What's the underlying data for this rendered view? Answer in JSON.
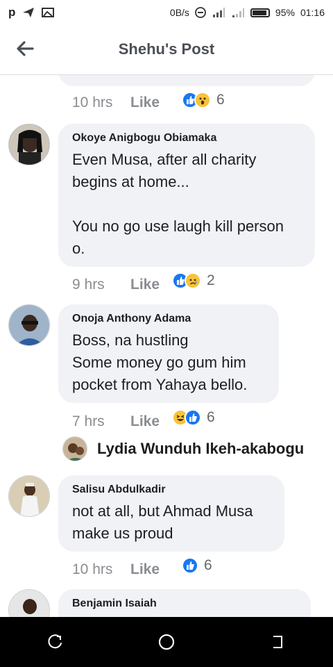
{
  "status_bar": {
    "left_icons": [
      "p-app-icon",
      "send-icon",
      "image-icon"
    ],
    "net_speed": "0B/s",
    "battery": "95%",
    "time": "01:16"
  },
  "header": {
    "title": "Shehu's Post"
  },
  "comments": [
    {
      "time": "10 hrs",
      "like": "Like",
      "reactions": [
        "like",
        "wow"
      ],
      "count": "6"
    },
    {
      "author": "Okoye Anigbogu Obiamaka",
      "text": "Even Musa, after all charity\nbegins at home...\n\nYou no go use laugh kill person\no.",
      "time": "9 hrs",
      "like": "Like",
      "reactions": [
        "like",
        "sad"
      ],
      "count": "2"
    },
    {
      "author": "Onoja Anthony Adama",
      "text": "Boss, na hustling\nSome money go gum him\npocket from Yahaya bello.",
      "time": "7 hrs",
      "like": "Like",
      "reactions": [
        "haha",
        "like"
      ],
      "count": "6"
    },
    {
      "author": "Salisu Abdulkadir",
      "text": "not at all, but Ahmad Musa\nmake us proud",
      "time": "10 hrs",
      "like": "Like",
      "reactions": [
        "like"
      ],
      "count": "6"
    },
    {
      "author": "Benjamin Isaiah"
    }
  ],
  "reply": {
    "name": "Lydia Wunduh Ikeh-akabogu"
  },
  "colors": {
    "bubble": "#f0f2f5",
    "like_blue": "#1877f2",
    "meta_gray": "#8a8d91"
  }
}
